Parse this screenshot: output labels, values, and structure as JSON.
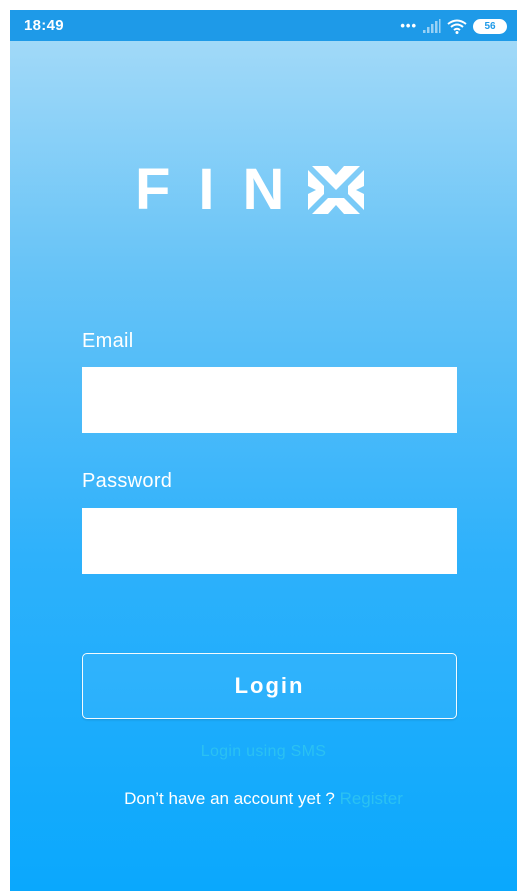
{
  "status_bar": {
    "time": "18:49",
    "signal_dots": "•••",
    "battery": "56",
    "icons": [
      "signal-icon",
      "wifi-icon",
      "battery-icon"
    ]
  },
  "logo": {
    "text": "FIN",
    "mark_icon": "finx-x-logo-icon"
  },
  "form": {
    "email_label": "Email",
    "email_value": "",
    "password_label": "Password",
    "password_value": ""
  },
  "actions": {
    "login_label": "Login",
    "sms_label": "Login using SMS",
    "no_account_text": "Don’t have an account yet ?",
    "register_label": "Register"
  },
  "colors": {
    "status_bar": "#1e9ae8",
    "background_top": "#a9dcf8",
    "background_bottom": "#0aa8fd",
    "link": "#2bc1f2"
  }
}
